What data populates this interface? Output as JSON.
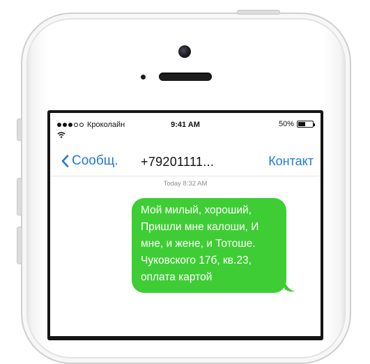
{
  "status_bar": {
    "signal_bars_filled": 3,
    "signal_bars_total": 5,
    "carrier": "Кроколайн",
    "time": "9:41 AM",
    "battery_text": "50%",
    "battery_level": 0.5
  },
  "nav": {
    "back_label": "Сообщ.",
    "title": "+79201111...",
    "contact_label": "Контакт"
  },
  "thread": {
    "timestamp": "Today 8:32 AM",
    "message": {
      "lines": [
        "Мой милый, хороший,",
        "Пришли мне калоши, И",
        "мне, и жене, и Тотоше.",
        "Чуковского 17б, кв.23,",
        "оплата картой"
      ]
    }
  },
  "colors": {
    "accent": "#1f7ad9",
    "bubble": "#3fcd35",
    "timestamp": "#8e8e8e"
  },
  "icons": [
    "camera-icon",
    "wifi-icon",
    "battery-icon",
    "chevron-left-icon"
  ]
}
